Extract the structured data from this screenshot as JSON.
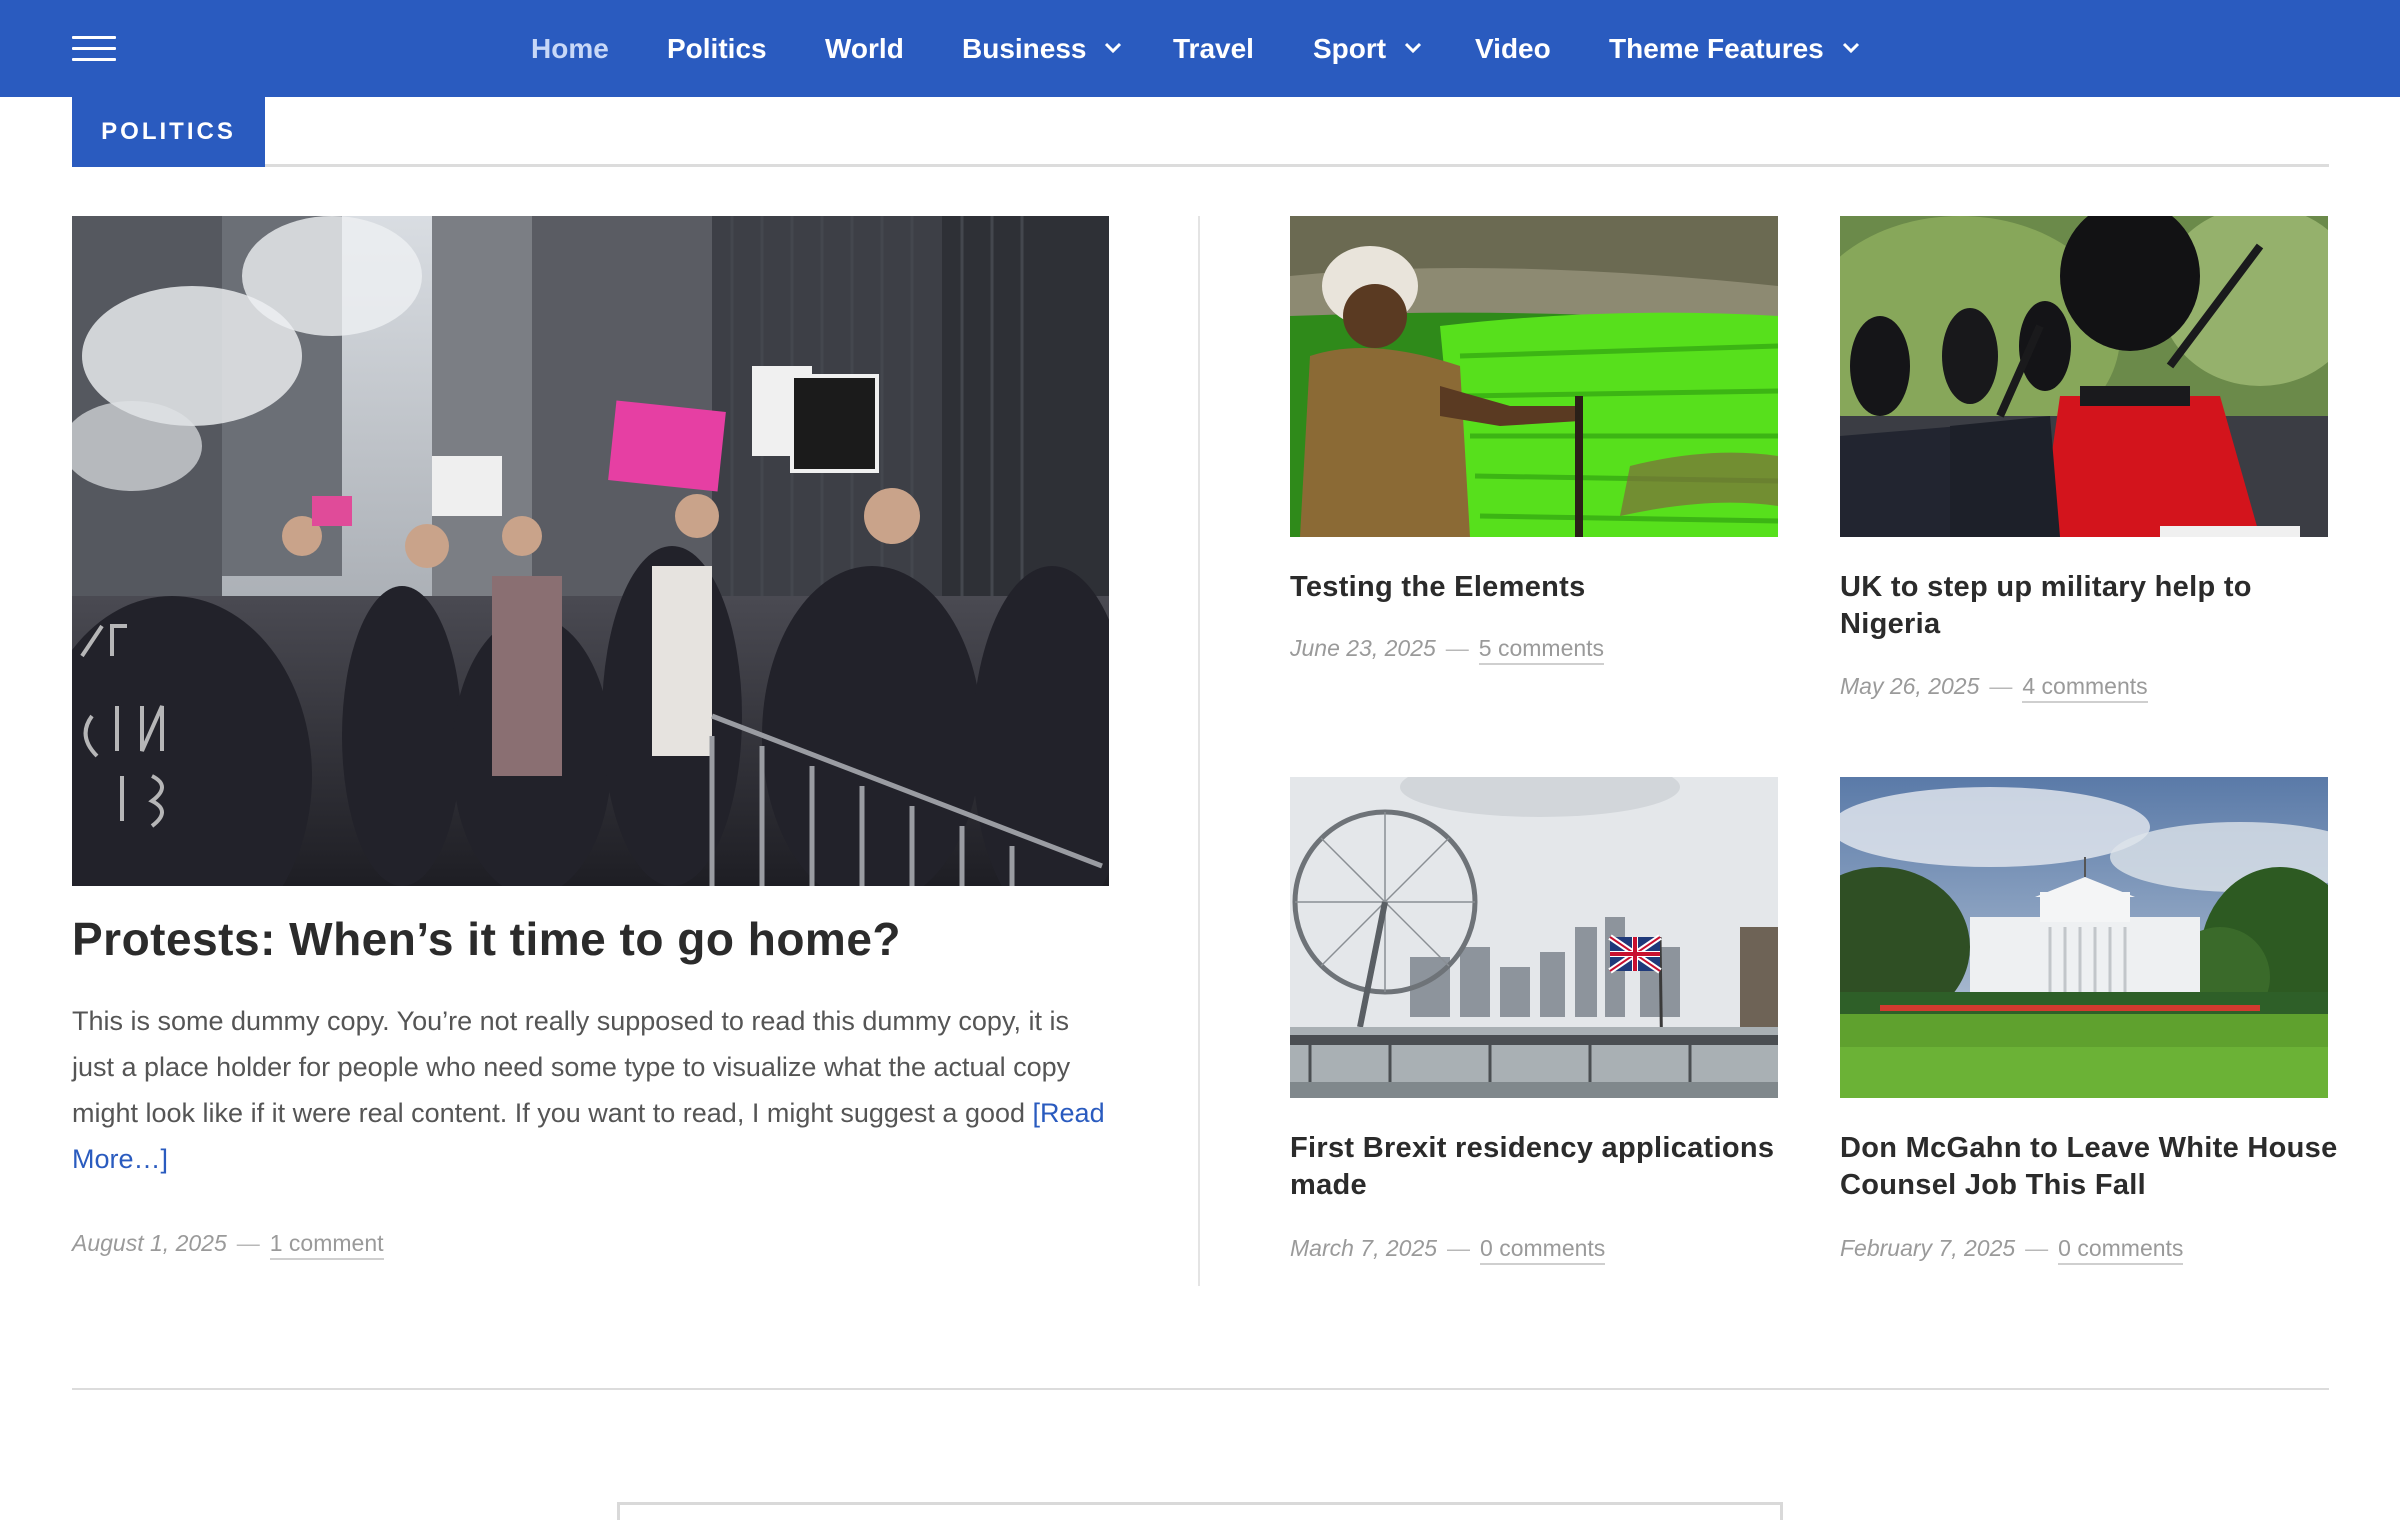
{
  "header": {
    "menu_icon": "hamburger-menu-icon",
    "nav": [
      {
        "label": "Home",
        "active": true,
        "dropdown": false
      },
      {
        "label": "Politics",
        "active": false,
        "dropdown": false
      },
      {
        "label": "World",
        "active": false,
        "dropdown": false
      },
      {
        "label": "Business",
        "active": false,
        "dropdown": true
      },
      {
        "label": "Travel",
        "active": false,
        "dropdown": false
      },
      {
        "label": "Sport",
        "active": false,
        "dropdown": true
      },
      {
        "label": "Video",
        "active": false,
        "dropdown": false
      },
      {
        "label": "Theme Features",
        "active": false,
        "dropdown": true
      }
    ]
  },
  "colors": {
    "brand": "#2a5bbf",
    "text": "#2b2b2b",
    "muted": "#9a9a9a"
  },
  "section": {
    "label": "POLITICS"
  },
  "feature": {
    "title": "Protests: When’s it time to go home?",
    "excerpt": "This is some dummy copy. You’re not really supposed to read this dummy copy, it is just a place holder for people who need some type to visualize what the actual copy might look like if it were real content. If you want to read, I might suggest a good",
    "read_more": "[Read More…]",
    "date": "August 1, 2025",
    "separator": "—",
    "comments": "1 comment"
  },
  "cards": [
    {
      "title": "Testing the Elements",
      "date": "June 23, 2025",
      "separator": "—",
      "comments": "5 comments"
    },
    {
      "title": "UK to step up military help to Nigeria",
      "date": "May 26, 2025",
      "separator": "—",
      "comments": "4 comments"
    },
    {
      "title": "First Brexit residency applications made",
      "date": "March 7, 2025",
      "separator": "—",
      "comments": "0 comments"
    },
    {
      "title": "Don McGahn to Leave White House Counsel Job This Fall",
      "date": "February 7, 2025",
      "separator": "—",
      "comments": "0 comments"
    }
  ]
}
